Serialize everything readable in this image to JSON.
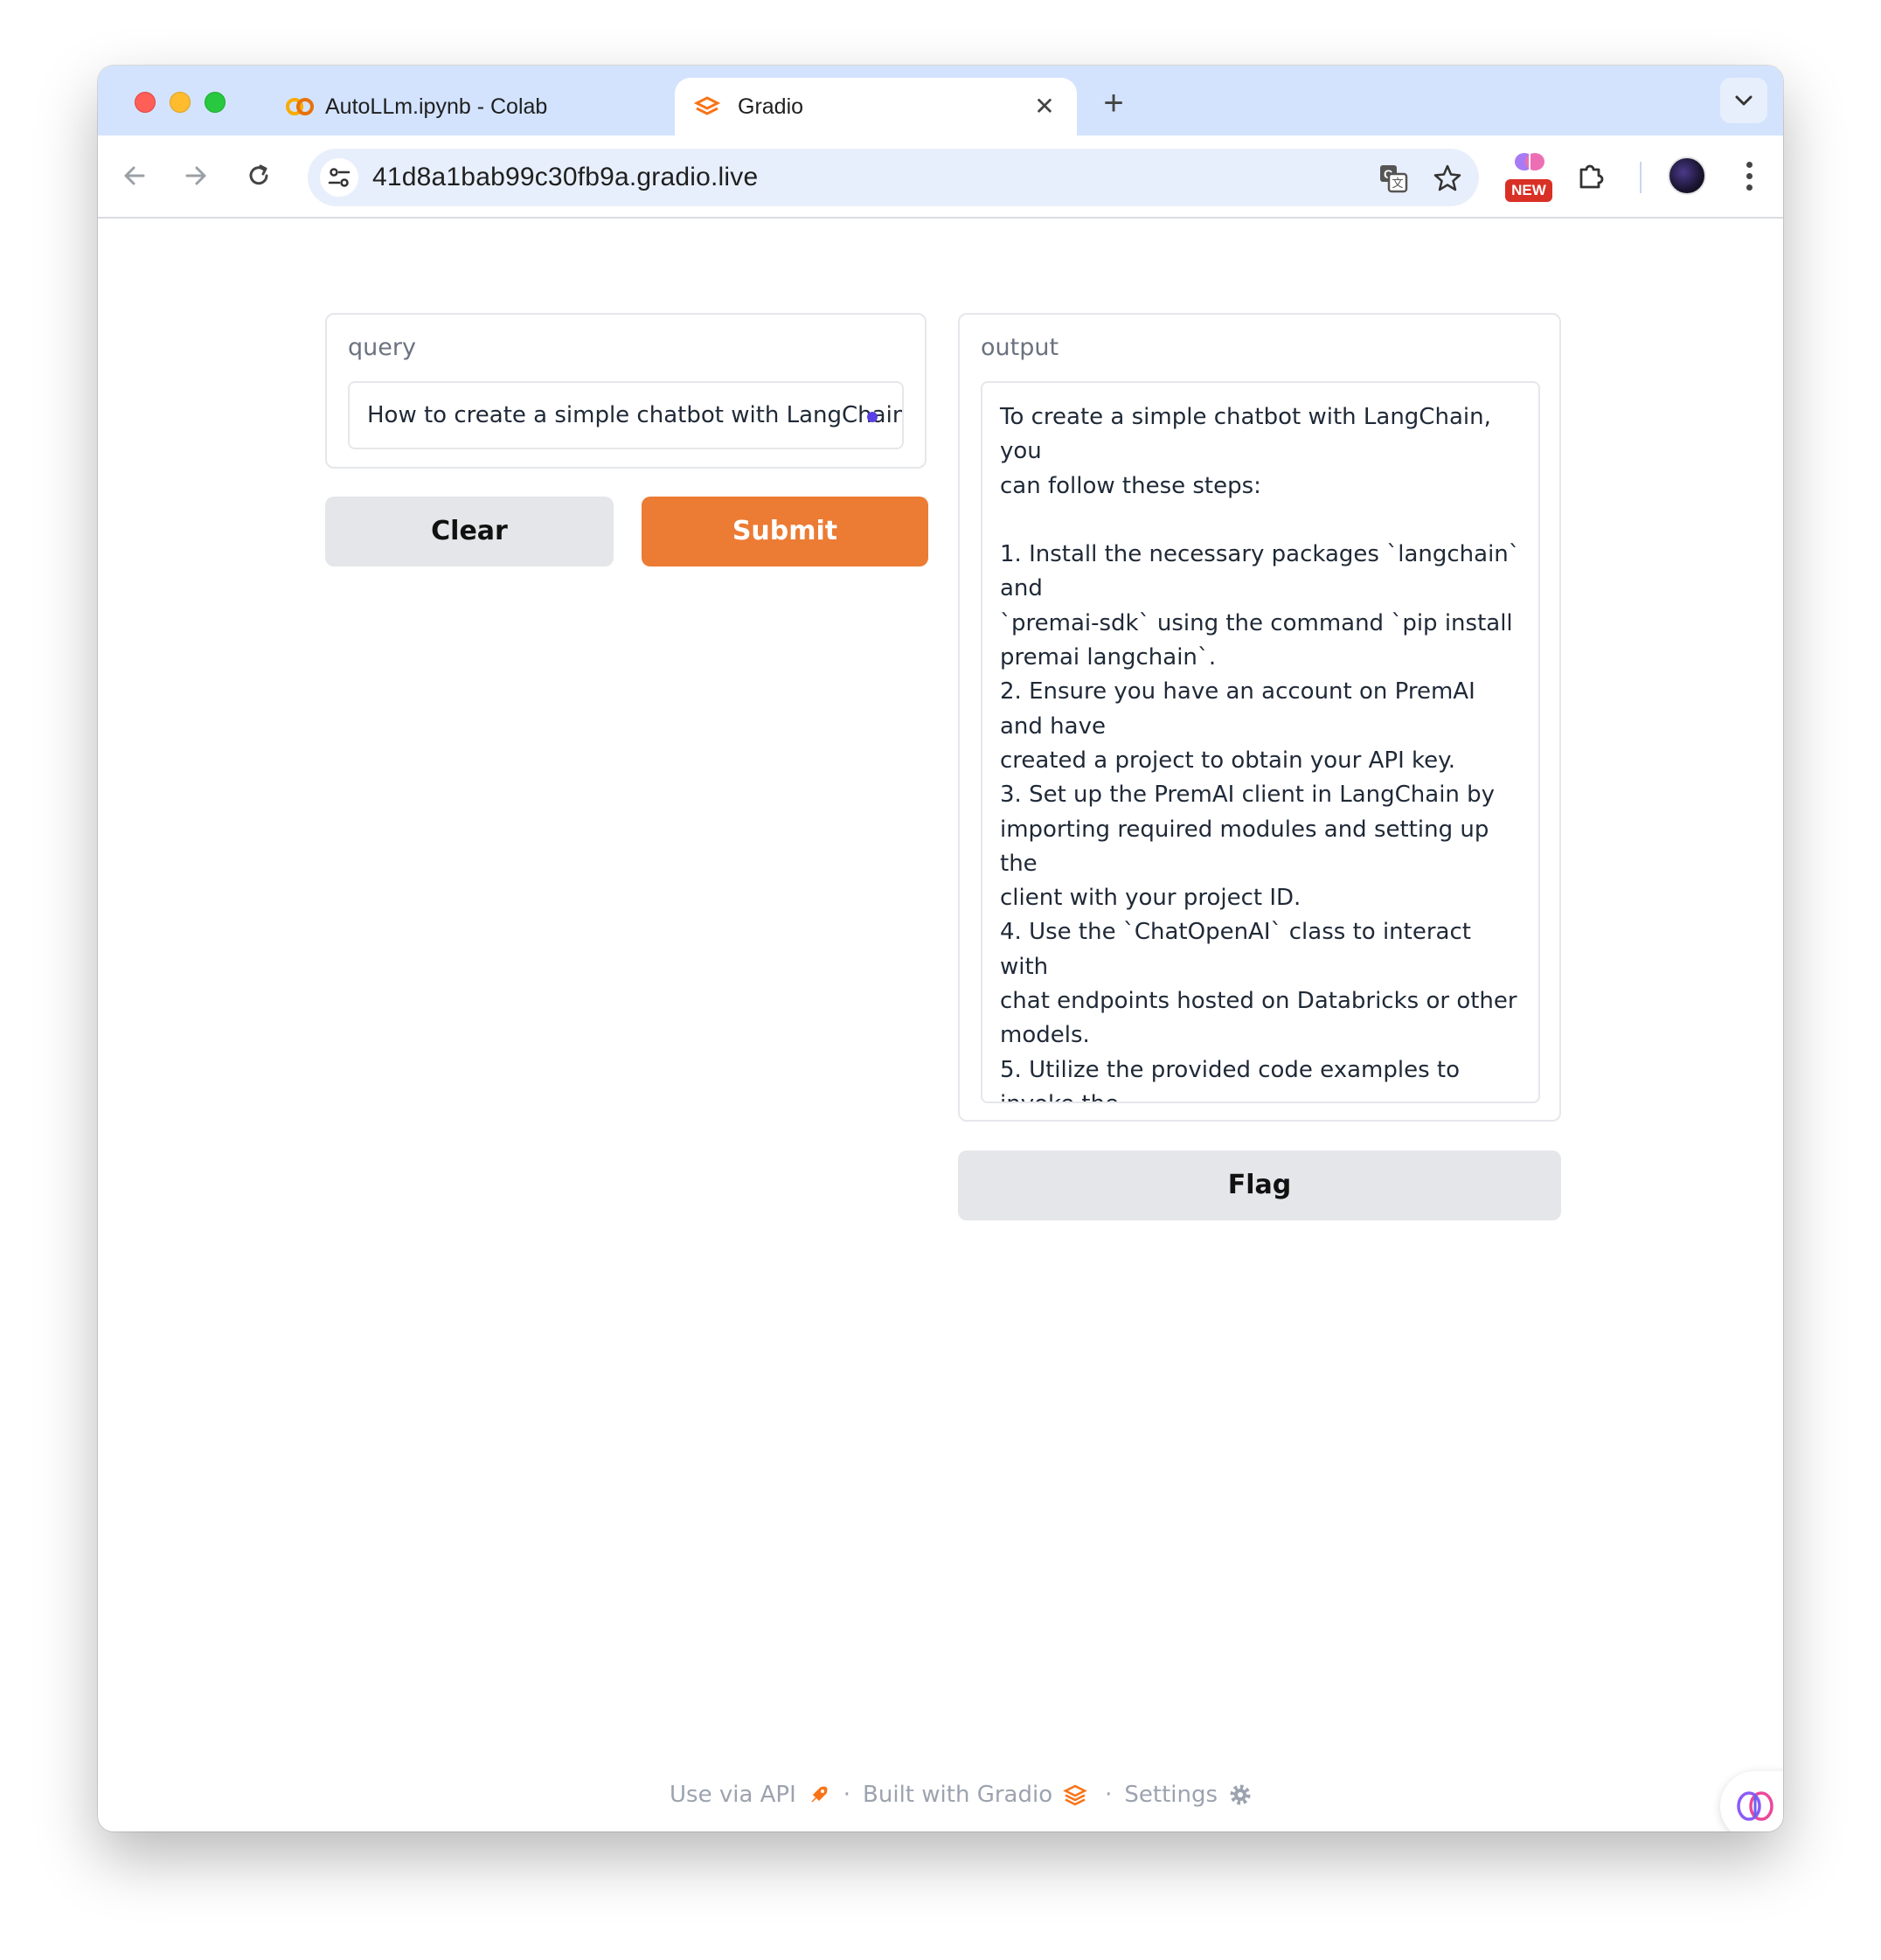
{
  "browser": {
    "tabs": [
      {
        "title": "AutoLLm.ipynb - Colab",
        "icon": "colab-icon",
        "active": false
      },
      {
        "title": "Gradio",
        "icon": "gradio-icon",
        "active": true
      }
    ],
    "url": "41d8a1bab99c30fb9a.gradio.live",
    "extension_badge": "NEW"
  },
  "app": {
    "query": {
      "label": "query",
      "value": "How to create a simple chatbot with LangChain?"
    },
    "buttons": {
      "clear": "Clear",
      "submit": "Submit",
      "flag": "Flag"
    },
    "output": {
      "label": "output",
      "text": "To create a simple chatbot with LangChain, you\ncan follow these steps:\n\n1. Install the necessary packages `langchain` and\n`premai-sdk` using the command `pip install\npremai langchain`.\n2. Ensure you have an account on PremAI and have\ncreated a project to obtain your API key.\n3. Set up the PremAI client in LangChain by\nimporting required modules and setting up the\nclient with your project ID.\n4. Use the `ChatOpenAI` class to interact with\nchat endpoints hosted on Databricks or other\nmodels.\n5. Utilize the provided code examples to invoke the\nchatbot with a question or prompt, such as \"What\nis the meaning of life, universe and everything?\"\n\nBy following these steps and utilizing the available\ntools and integrations, you can easily create a\nsimple chatbot using LangChain."
    },
    "footer": {
      "api": "Use via API",
      "built": "Built with Gradio",
      "settings": "Settings",
      "separator": "·"
    }
  },
  "colors": {
    "accent": "#ec7b34",
    "tabstrip": "#d3e3fd",
    "omnibox": "#e8effc"
  }
}
